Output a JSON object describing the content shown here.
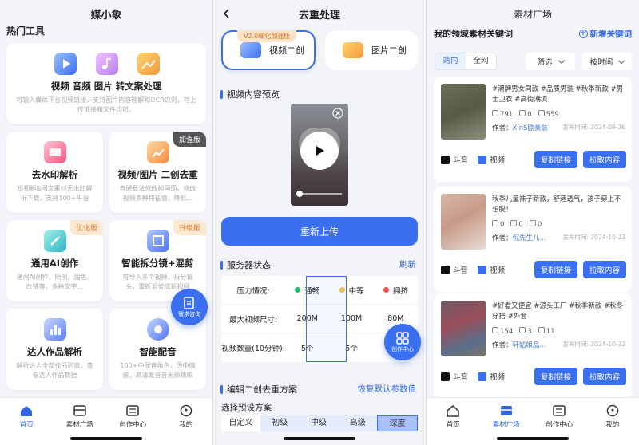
{
  "screen1": {
    "title": "媒小象",
    "section": "热门工具",
    "top_card": {
      "title": "视频 音频 图片 转文案处理",
      "desc": "可输入媒体平台视频链接，支持图片内容理解和OCR识别，可上传链接和文件均可。"
    },
    "cards": [
      {
        "title": "去水印解析",
        "desc": "短视频&图文素材无水印解析下载，支持100+平台",
        "badge": ""
      },
      {
        "title": "视频/图片 二创去重",
        "desc": "自研算法修改帧画面，修改视频多种特征值，降低...",
        "badge": "加强版"
      },
      {
        "title": "通用AI创作",
        "desc": "通用AI创作，限创、润色、改错等，多种文字...",
        "badge": "优化版"
      },
      {
        "title": "智能拆分镜+混剪",
        "desc": "可导入多个视频，拆分镜头，重新混剪成新视频",
        "badge": "升级版"
      },
      {
        "title": "达人作品解析",
        "desc": "解析达人全部作品列表，查看达人作品数据",
        "badge": ""
      },
      {
        "title": "智能配音",
        "desc": "100+中配音角色，历中情感，高清发音音无损精练",
        "badge": ""
      }
    ],
    "float_label": "需求咨询",
    "tabs": [
      {
        "label": "首页",
        "icon": "home-icon"
      },
      {
        "label": "素材广场",
        "icon": "box-icon"
      },
      {
        "label": "创作中心",
        "icon": "creation-icon"
      },
      {
        "label": "我的",
        "icon": "user-icon"
      }
    ]
  },
  "screen2": {
    "title": "去重处理",
    "version_tag": "V2.0细化加强版",
    "mode_video": "视频二创",
    "mode_image": "图片二创",
    "preview_title": "视频内容预览",
    "reupload": "重新上传",
    "server_title": "服务器状态",
    "refresh": "刷新",
    "rows": [
      {
        "label": "压力情况:",
        "c1": "通畅",
        "c2": "中等",
        "c3": "拥挤"
      },
      {
        "label": "最大视频尺寸:",
        "c1": "200M",
        "c2": "100M",
        "c3": "80M"
      },
      {
        "label": "视频数量(10分钟):",
        "c1": "5个",
        "c2": "5个",
        "c3": ""
      }
    ],
    "float_label": "创作中心",
    "edit_title": "编辑二创去重方案",
    "restore": "恢复默认参数值",
    "preset_title": "选择预设方案",
    "presets": [
      "自定义",
      "初级",
      "中级",
      "高级",
      "深度"
    ]
  },
  "screen3": {
    "title": "素材广场",
    "kw_title": "我的领域素材关键词",
    "kw_add": "新增关键词",
    "seg": [
      "站内",
      "全网"
    ],
    "filter": "筛选",
    "sort": "按时间",
    "items": [
      {
        "text": "#潮牌男女同款 #品质男装 #秋季新款 #男士卫衣 #高街潮流",
        "likes": "791",
        "comments": "0",
        "shares": "559",
        "author_label": "作者：",
        "author": "XinS欧美装",
        "date": "发布时间: 2024-09-26"
      },
      {
        "text": "秋季儿童袜子新款，舒适透气，孩子穿上不想脱！",
        "likes": "0",
        "comments": "0",
        "shares": "0",
        "author_label": "作者：",
        "author": "倪先生儿...",
        "date": "发布时间: 2024-10-23"
      },
      {
        "text": "#好看又便宜 #源头工厂 #秋季新款 #秋冬穿搭 #外套",
        "likes": "154",
        "comments": "3",
        "shares": "11",
        "author_label": "作者：",
        "author": "轩姑娘品...",
        "date": "发布时间: 2024-10-22"
      }
    ],
    "platform": "斗音",
    "type_label": "视频",
    "copy_btn": "复制链接",
    "pull_btn": "拉取内容",
    "tabs": [
      {
        "label": "首页",
        "icon": "home-icon"
      },
      {
        "label": "素材广场",
        "icon": "box-icon"
      },
      {
        "label": "创作中心",
        "icon": "creation-icon"
      },
      {
        "label": "我的",
        "icon": "user-icon"
      }
    ]
  },
  "colors": {
    "accent": "#3a6ff0",
    "badge_orange": "#fde8d2",
    "green": "#1fbf6a",
    "yellow": "#f2c14a",
    "red": "#e8524a"
  }
}
